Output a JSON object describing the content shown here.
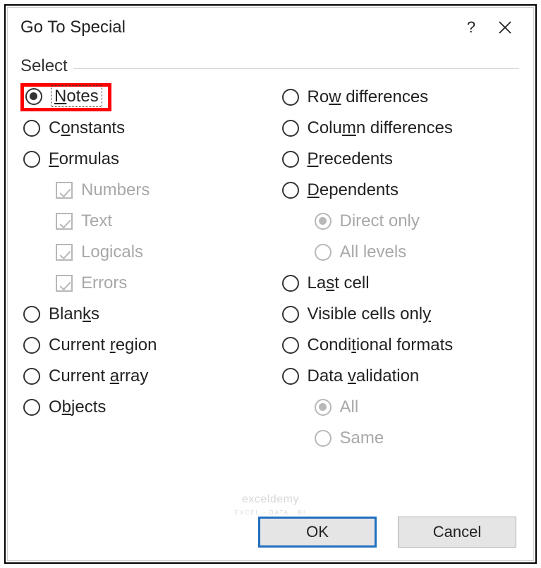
{
  "title": "Go To Special",
  "help_symbol": "?",
  "group_label": "Select",
  "left": {
    "notes": "Notes",
    "constants": "Constants",
    "formulas": "Formulas",
    "numbers": "Numbers",
    "text": "Text",
    "logicals": "Logicals",
    "errors": "Errors",
    "blanks": "Blanks",
    "current_region": "Current region",
    "current_array": "Current array",
    "objects": "Objects"
  },
  "right": {
    "row_diff": "Row differences",
    "col_diff": "Column differences",
    "precedents": "Precedents",
    "dependents": "Dependents",
    "direct_only": "Direct only",
    "all_levels": "All levels",
    "last_cell": "Last cell",
    "visible": "Visible cells only",
    "cond_formats": "Conditional formats",
    "data_validation": "Data validation",
    "all": "All",
    "same": "Same"
  },
  "buttons": {
    "ok": "OK",
    "cancel": "Cancel"
  },
  "selected": "notes",
  "watermark": {
    "main": "exceldemy",
    "sub": "EXCEL · DATA · BI"
  }
}
